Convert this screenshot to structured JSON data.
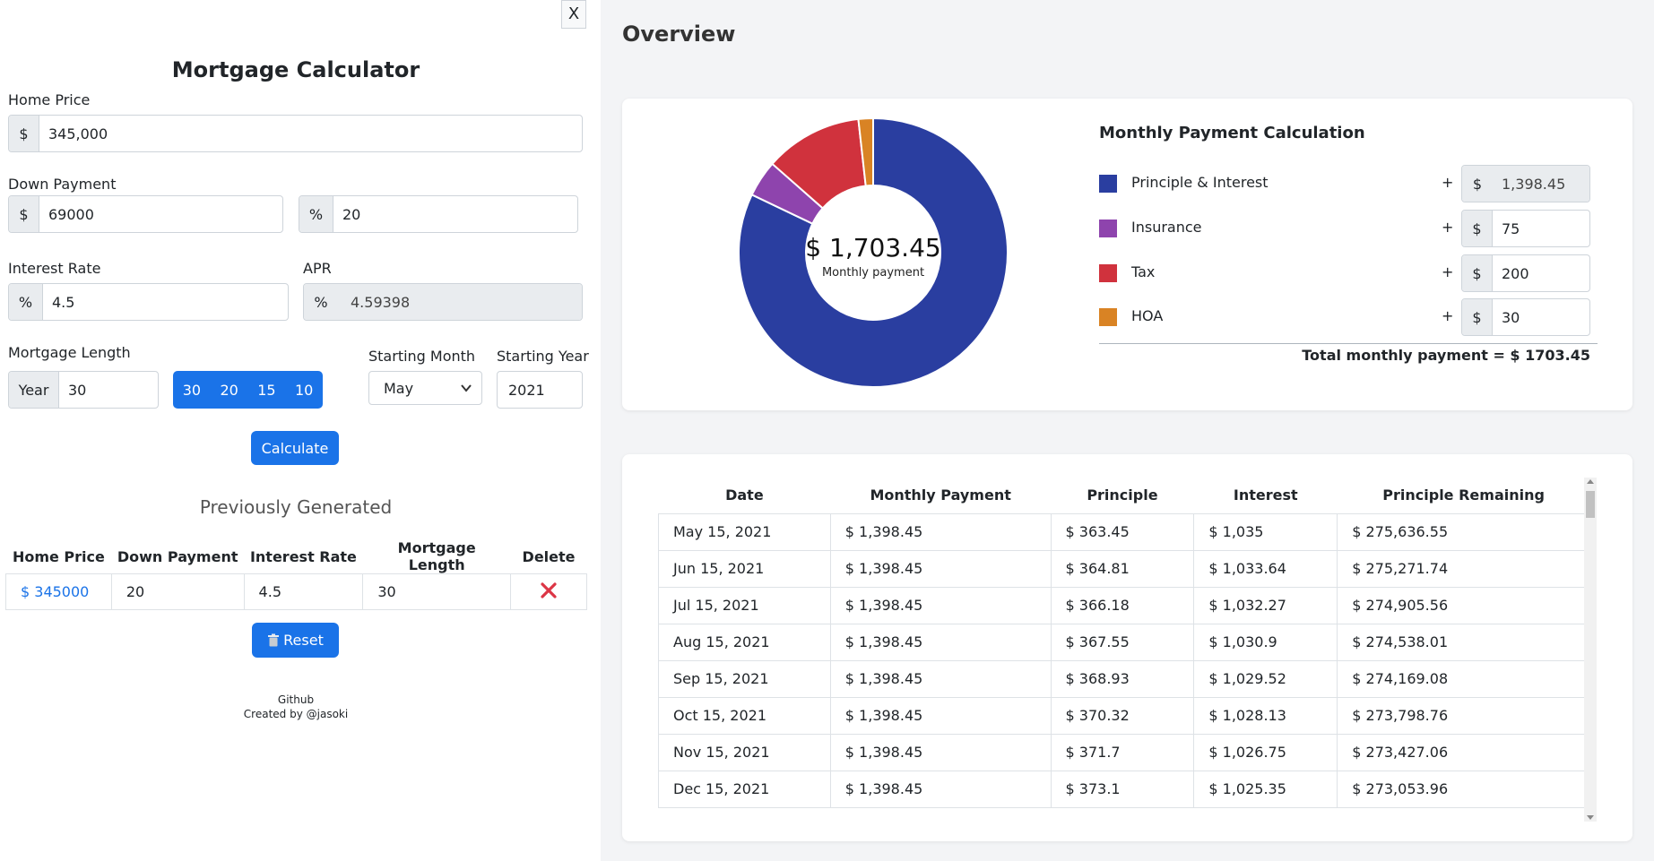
{
  "calculator": {
    "close_label": "X",
    "title": "Mortgage Calculator",
    "home_price": {
      "label": "Home Price",
      "prefix": "$",
      "value": "345,000"
    },
    "down_payment": {
      "label": "Down Payment",
      "prefix": "$",
      "value": "69000",
      "pct_prefix": "%",
      "pct_value": "20"
    },
    "interest_rate": {
      "label": "Interest Rate",
      "prefix": "%",
      "value": "4.5"
    },
    "apr": {
      "label": "APR",
      "prefix": "%",
      "value": "4.59398"
    },
    "mortgage_length": {
      "label": "Mortgage Length",
      "prefix": "Year",
      "value": "30",
      "options": [
        "30",
        "20",
        "15",
        "10"
      ]
    },
    "starting_month": {
      "label": "Starting Month",
      "value": "May"
    },
    "starting_year": {
      "label": "Starting Year",
      "value": "2021"
    },
    "calculate_label": "Calculate"
  },
  "history": {
    "title": "Previously Generated",
    "columns": [
      "Home Price",
      "Down Payment",
      "Interest Rate",
      "Mortgage Length",
      "Delete"
    ],
    "rows": [
      {
        "home_price": "$ 345000",
        "down_payment": "20",
        "interest_rate": "4.5",
        "mortgage_length": "30"
      }
    ],
    "reset_label": "Reset"
  },
  "footer": {
    "link": "Github",
    "credit": "Created by @jasoki"
  },
  "overview": {
    "title": "Overview",
    "center_amount": "$ 1,703.45",
    "center_caption": "Monthly payment",
    "breakdown_title": "Monthly Payment Calculation",
    "items": [
      {
        "label": "Principle & Interest",
        "color": "#2a3ea0",
        "prefix": "$",
        "plus": "+",
        "value": "1,398.45",
        "amount": 1398.45,
        "readonly": true
      },
      {
        "label": "Insurance",
        "color": "#8e44ad",
        "prefix": "$",
        "plus": "+",
        "value": "75",
        "amount": 75
      },
      {
        "label": "Tax",
        "color": "#d0323d",
        "prefix": "$",
        "plus": "+",
        "value": "200",
        "amount": 200
      },
      {
        "label": "HOA",
        "color": "#d98324",
        "prefix": "$",
        "plus": "+",
        "value": "30",
        "amount": 30
      }
    ],
    "total": "Total monthly payment = $ 1703.45"
  },
  "chart_data": {
    "type": "pie",
    "categories": [
      "Principle & Interest",
      "Insurance",
      "Tax",
      "HOA"
    ],
    "values": [
      1398.45,
      75,
      200,
      30
    ],
    "colors": [
      "#2a3ea0",
      "#8e44ad",
      "#d0323d",
      "#d98324"
    ],
    "title": "",
    "hole": true
  },
  "amortization": {
    "columns": [
      "Date",
      "Monthly Payment",
      "Principle",
      "Interest",
      "Principle Remaining"
    ],
    "rows": [
      [
        "May 15, 2021",
        "$ 1,398.45",
        "$ 363.45",
        "$ 1,035",
        "$ 275,636.55"
      ],
      [
        "Jun 15, 2021",
        "$ 1,398.45",
        "$ 364.81",
        "$ 1,033.64",
        "$ 275,271.74"
      ],
      [
        "Jul 15, 2021",
        "$ 1,398.45",
        "$ 366.18",
        "$ 1,032.27",
        "$ 274,905.56"
      ],
      [
        "Aug 15, 2021",
        "$ 1,398.45",
        "$ 367.55",
        "$ 1,030.9",
        "$ 274,538.01"
      ],
      [
        "Sep 15, 2021",
        "$ 1,398.45",
        "$ 368.93",
        "$ 1,029.52",
        "$ 274,169.08"
      ],
      [
        "Oct 15, 2021",
        "$ 1,398.45",
        "$ 370.32",
        "$ 1,028.13",
        "$ 273,798.76"
      ],
      [
        "Nov 15, 2021",
        "$ 1,398.45",
        "$ 371.7",
        "$ 1,026.75",
        "$ 273,427.06"
      ],
      [
        "Dec 15, 2021",
        "$ 1,398.45",
        "$ 373.1",
        "$ 1,025.35",
        "$ 273,053.96"
      ]
    ]
  }
}
